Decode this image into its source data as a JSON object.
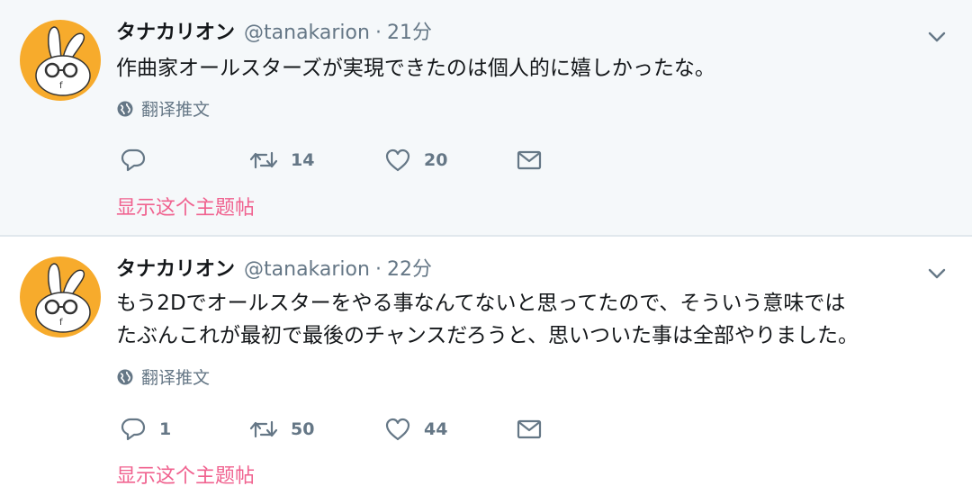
{
  "tweets": [
    {
      "display_name": "タナカリオン",
      "handle": "@tanakarion",
      "separator": "·",
      "time": "21分",
      "text_lines": [
        "作曲家オールスターズが実現できたのは個人的に嬉しかったな。"
      ],
      "translate_label": "翻译推文",
      "reply_count": "",
      "retweet_count": "14",
      "like_count": "20",
      "thread_link": "显示这个主题帖"
    },
    {
      "display_name": "タナカリオン",
      "handle": "@tanakarion",
      "separator": "·",
      "time": "22分",
      "text_lines": [
        "もう2Dでオールスターをやる事なんてないと思ってたので、そういう意味では",
        "たぶんこれが最初で最後のチャンスだろうと、思いついた事は全部やりました。"
      ],
      "translate_label": "翻译推文",
      "reply_count": "1",
      "retweet_count": "50",
      "like_count": "44",
      "thread_link": "显示这个主题帖"
    }
  ],
  "icons": {
    "reply": "reply-icon",
    "retweet": "retweet-icon",
    "like": "heart-icon",
    "dm": "envelope-icon",
    "caret": "chevron-down-icon",
    "globe": "globe-icon"
  },
  "colors": {
    "icon_gray": "#657786",
    "thread_link": "#f0628f",
    "avatar_bg": "#f7ab2c",
    "top_tweet_bg": "#f5f8fa"
  }
}
